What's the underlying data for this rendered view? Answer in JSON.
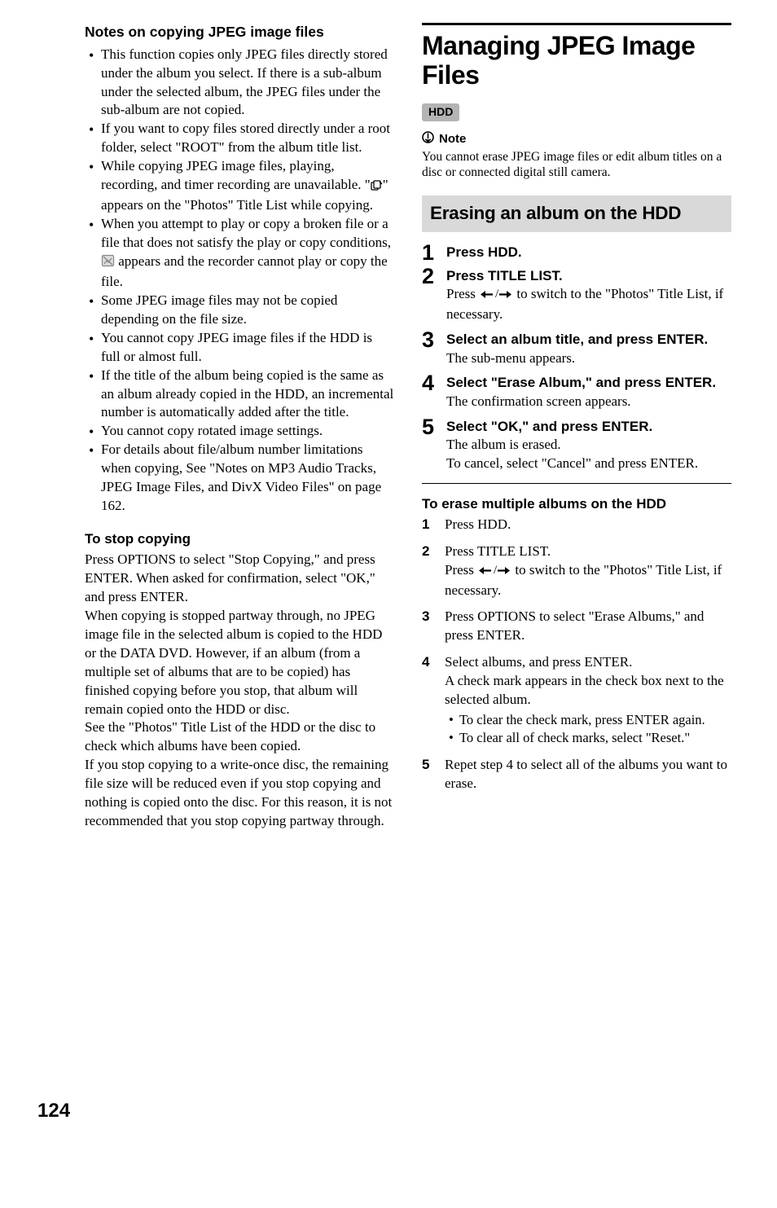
{
  "left": {
    "notes_heading": "Notes on copying JPEG image files",
    "bullets": [
      "This function copies only JPEG files directly stored under the album you select. If there is a sub-album under the selected album, the JPEG files under the sub-album are not copied.",
      "If you want to copy files stored directly under a root folder, select \"ROOT\" from the album title list.",
      "While copying JPEG image files, playing, recording, and timer recording are unavailable. \"__COPYICON__\" appears on the \"Photos\" Title List while copying.",
      "When you attempt to play or copy a broken file or a file that does not satisfy the play or copy conditions, __BROKENICON__ appears and the recorder cannot play or copy the file.",
      "Some JPEG image files may not be copied depending on the file size.",
      "You cannot copy JPEG image files if the HDD is full or almost full.",
      "If the title of the album being copied is the same as an album already copied in the HDD, an incremental number is automatically added after the title.",
      "You cannot copy rotated image settings.",
      "For details about file/album number limitations when copying, See \"Notes on MP3 Audio Tracks, JPEG Image Files, and DivX Video Files\" on page 162."
    ],
    "stop_heading": "To stop copying",
    "stop_body": "Press OPTIONS to select \"Stop Copying,\" and press ENTER. When asked for confirmation, select \"OK,\" and press ENTER.\nWhen copying is stopped partway through, no JPEG image file in the selected album is copied to the HDD or the DATA DVD. However, if an album (from a multiple set of albums that are to be copied) has finished copying before you stop, that album will remain copied onto the HDD or disc.\nSee the \"Photos\" Title List of the HDD or the disc to check which albums have been copied.\nIf you stop copying to a write-once disc, the remaining file size will be reduced even if you stop copying and nothing is copied onto the disc. For this reason, it is not recommended that you stop copying partway through."
  },
  "right": {
    "title": "Managing JPEG Image Files",
    "pill": "HDD",
    "note_label": "Note",
    "note_text": "You cannot erase JPEG image files or edit album titles on a disc or connected digital still camera.",
    "graybar": "Erasing an album on the HDD",
    "steps": [
      {
        "title": "Press HDD.",
        "body": ""
      },
      {
        "title": "Press TITLE LIST.",
        "body": "Press __ARROWS__ to switch to the \"Photos\" Title List, if necessary."
      },
      {
        "title": "Select an album title, and press ENTER.",
        "body": "The sub-menu appears."
      },
      {
        "title": "Select \"Erase Album,\" and press ENTER.",
        "body": "The confirmation screen appears."
      },
      {
        "title": "Select \"OK,\" and press ENTER.",
        "body": "The album is erased.\nTo cancel, select \"Cancel\" and press ENTER."
      }
    ],
    "sub_heading": "To erase multiple albums on the HDD",
    "small_steps": [
      {
        "body": "Press HDD."
      },
      {
        "body": "Press TITLE LIST.\nPress __ARROWS__ to switch to the \"Photos\" Title List, if necessary."
      },
      {
        "body": "Press OPTIONS to select \"Erase Albums,\" and press ENTER."
      },
      {
        "body": "Select albums, and press ENTER.\nA check mark appears in the check box next to the selected album.",
        "bullets": [
          "To clear the check mark, press ENTER again.",
          "To clear all of check marks, select \"Reset.\""
        ]
      },
      {
        "body": "Repet step 4 to select all of the albums you want to erase."
      }
    ]
  },
  "page_number": "124"
}
